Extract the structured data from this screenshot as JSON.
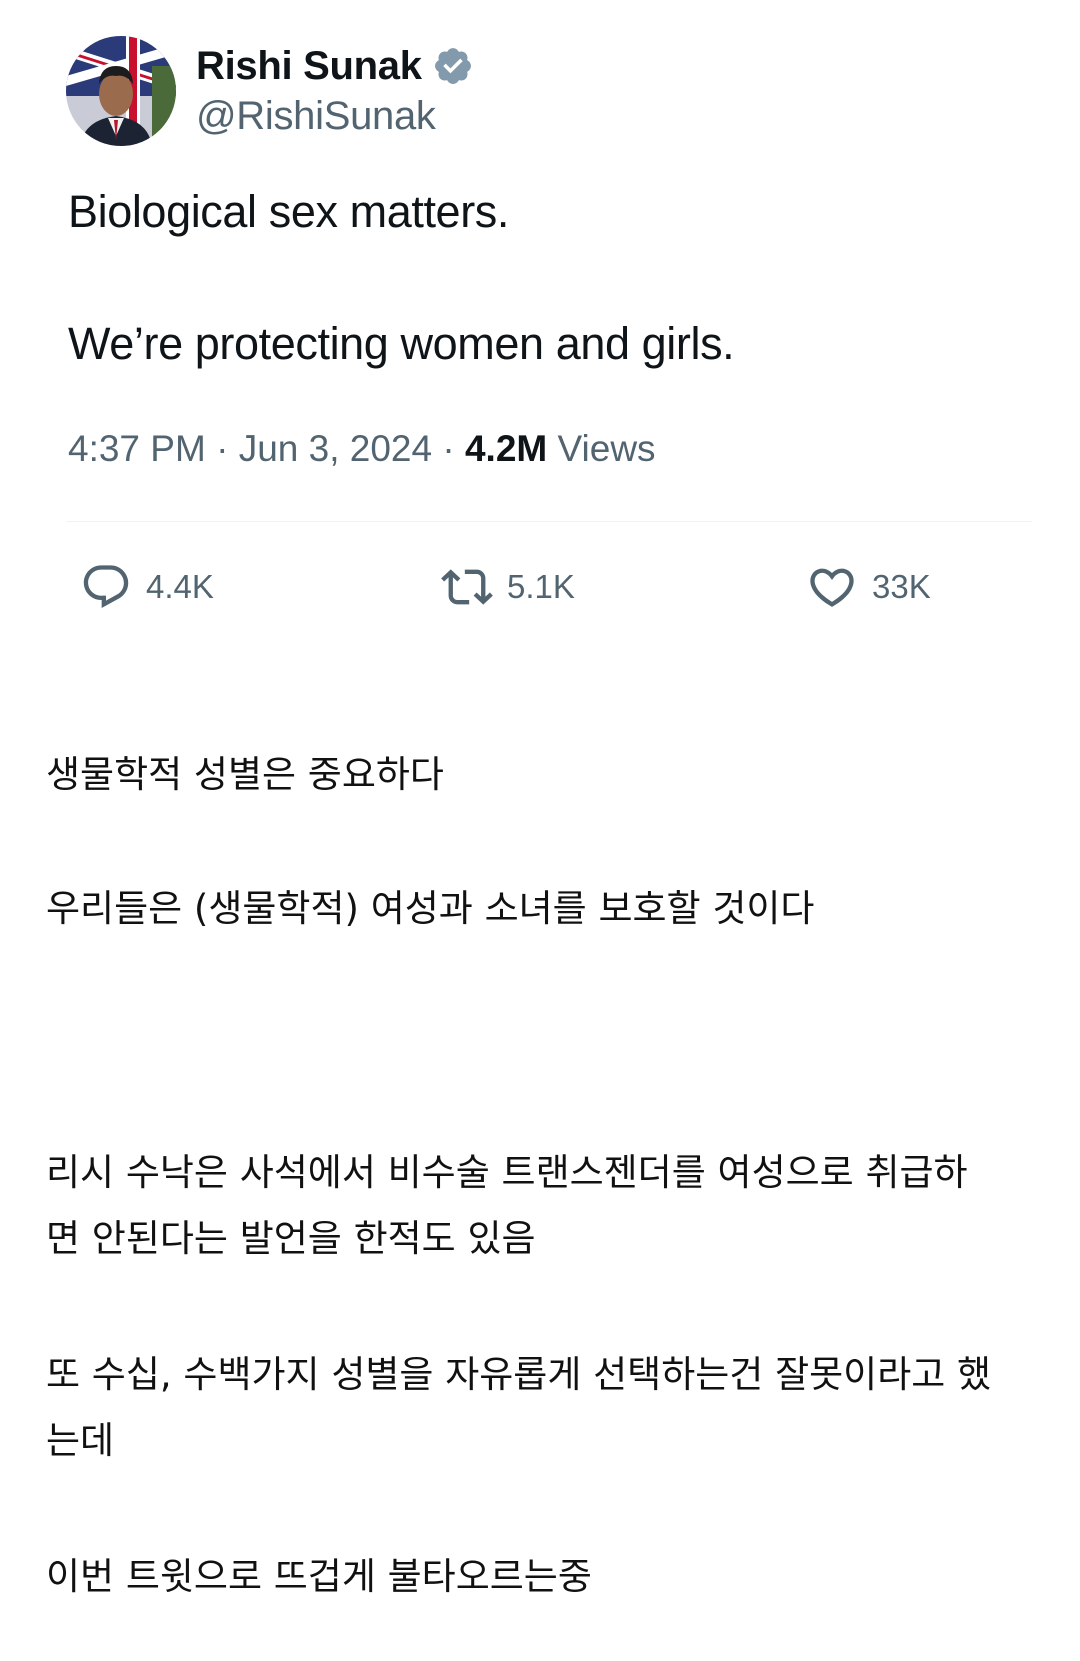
{
  "tweet": {
    "display_name": "Rishi Sunak",
    "verified_icon": "verified-badge-icon",
    "handle": "@RishiSunak",
    "lines": [
      "Biological sex matters.",
      "We’re protecting women and girls."
    ],
    "meta": {
      "time": "4:37 PM",
      "separator": "·",
      "date": "Jun 3, 2024",
      "views_count": "4.2M",
      "views_label": "Views"
    },
    "actions": {
      "reply": {
        "icon": "reply-icon",
        "count": "4.4K"
      },
      "retweet": {
        "icon": "retweet-icon",
        "count": "5.1K"
      },
      "like": {
        "icon": "heart-icon",
        "count": "33K"
      }
    },
    "colors": {
      "verified": "#829aab",
      "secondary_text": "#536471",
      "primary_text": "#0f1419"
    }
  },
  "commentary": {
    "lines": [
      "생물학적 성별은 중요하다",
      "우리들은 (생물학적) 여성과 소녀를 보호할 것이다",
      "리시 수낙은 사석에서 비수술 트랜스젠더를 여성으로 취급하",
      "면 안된다는 발언을 한적도 있음",
      "또 수십, 수백가지 성별을 자유롭게 선택하는건 잘못이라고 했",
      "는데",
      "이번 트윗으로 뜨겁게 불타오르는중"
    ]
  }
}
